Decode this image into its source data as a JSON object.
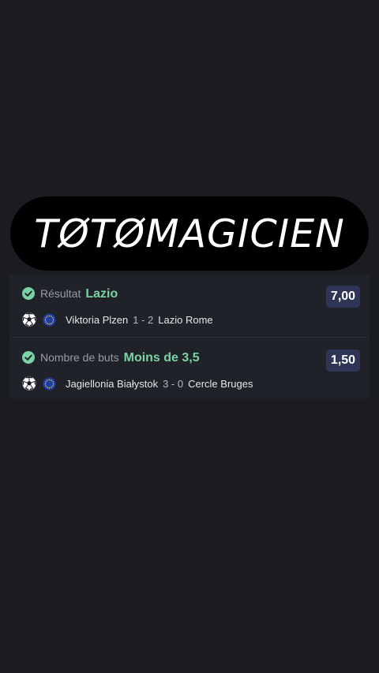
{
  "brand": {
    "text": "TØTØMAGICIEN"
  },
  "bets": [
    {
      "market": "Résultat",
      "selection": "Lazio",
      "odds": "7,00",
      "home": "Viktoria Plzen",
      "score": "1 - 2",
      "away": "Lazio Rome",
      "sport_icon": "soccer-ball-icon",
      "competition_icon": "europe-flag-icon",
      "status_icon": "check-circle-icon"
    },
    {
      "market": "Nombre de buts",
      "selection": "Moins de 3,5",
      "odds": "1,50",
      "home": "Jagiellonia Białystok",
      "score": "3 - 0",
      "away": "Cercle Bruges",
      "sport_icon": "soccer-ball-icon",
      "competition_icon": "europe-flag-icon",
      "status_icon": "check-circle-icon"
    }
  ],
  "colors": {
    "background": "#1b1c21",
    "card": "#202229",
    "accent_green": "#7ad3a2",
    "odds_badge": "#2e3556"
  }
}
